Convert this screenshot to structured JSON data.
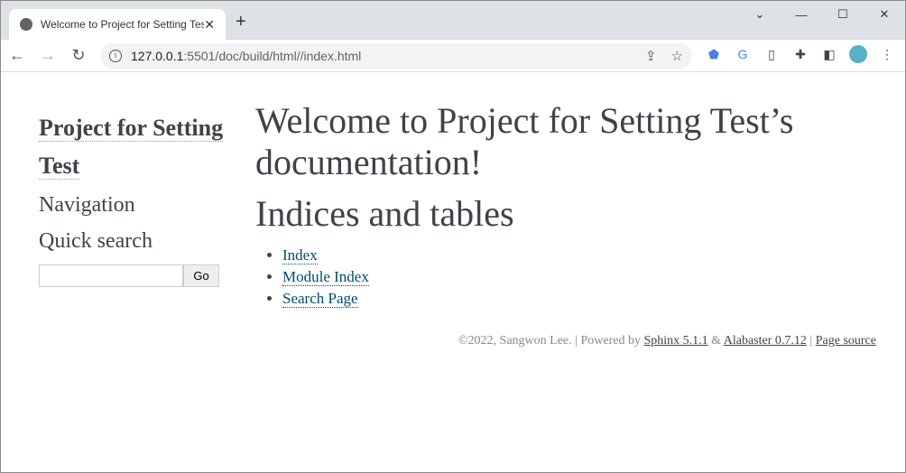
{
  "browser": {
    "tab_title": "Welcome to Project for Setting Test",
    "url_host": "127.0.0.1",
    "url_rest": ":5501/doc/build/html//index.html"
  },
  "sidebar": {
    "logo": "Project for Setting Test",
    "navigation": "Navigation",
    "quick_search": "Quick search",
    "go": "Go",
    "search_value": ""
  },
  "main": {
    "title": "Welcome to Project for Setting Test’s documentation!",
    "section": "Indices and tables",
    "links": [
      "Index",
      "Module Index",
      "Search Page"
    ]
  },
  "footer": {
    "copyright": "©2022, Sangwon Lee.",
    "sep1": " | Powered by ",
    "sphinx": "Sphinx 5.1.1",
    "amp": " & ",
    "alabaster": "Alabaster 0.7.12",
    "sep2": " | ",
    "source": "Page source"
  }
}
